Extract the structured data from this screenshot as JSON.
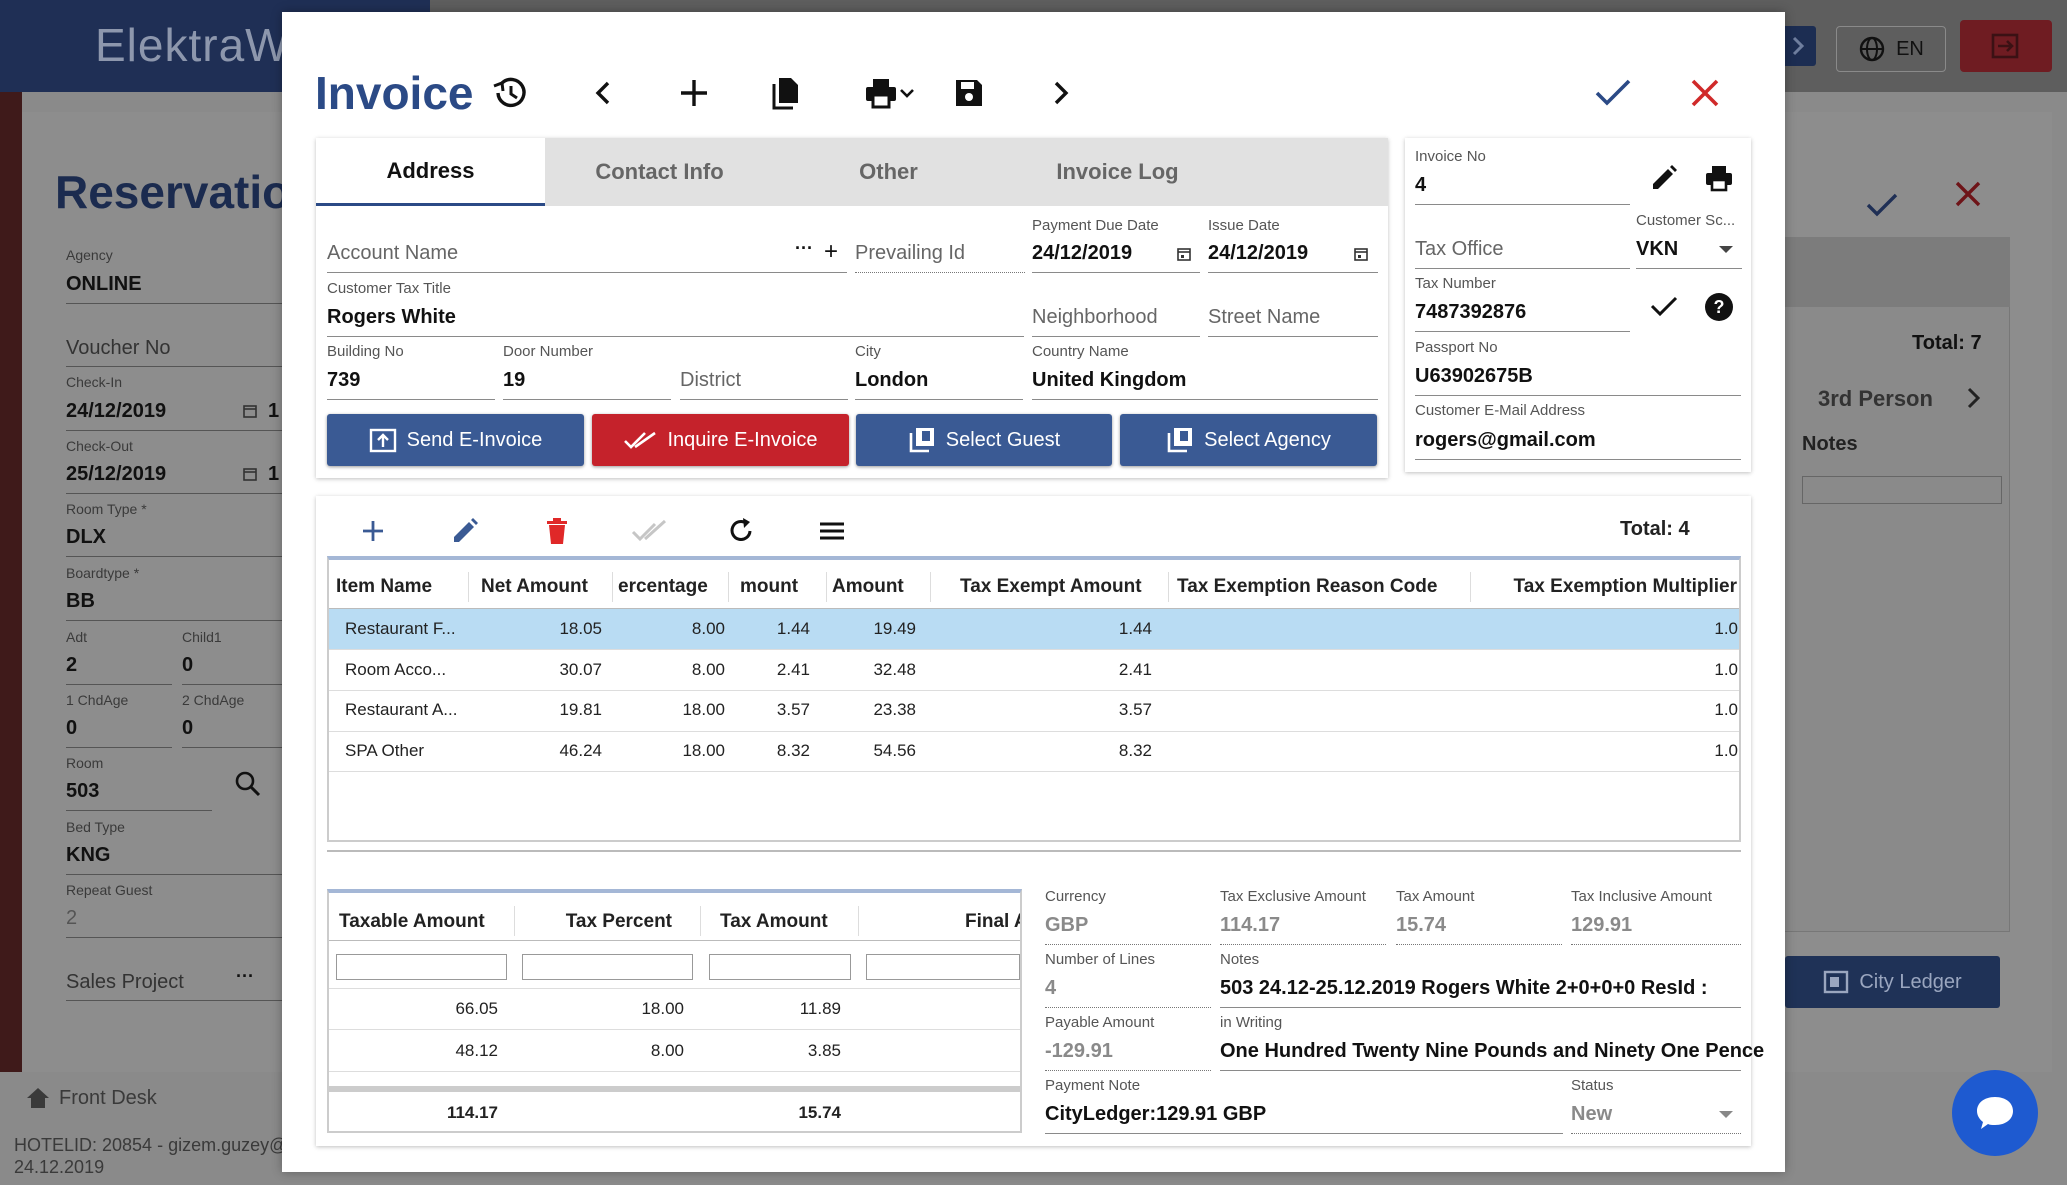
{
  "background": {
    "app_name": "ElektraW",
    "language": "EN",
    "reservation_title": "Reservation",
    "fields": {
      "agency": {
        "label": "Agency",
        "value": "ONLINE"
      },
      "voucher_no": {
        "placeholder": "Voucher No"
      },
      "check_in": {
        "label": "Check-In",
        "value": "24/12/2019",
        "extra": "1"
      },
      "check_out": {
        "label": "Check-Out",
        "value": "25/12/2019",
        "extra": "1"
      },
      "room_type": {
        "label": "Room Type *",
        "value": "DLX"
      },
      "boardtype": {
        "label": "Boardtype *",
        "value": "BB"
      },
      "adt": {
        "label": "Adt",
        "value": "2"
      },
      "child1": {
        "label": "Child1",
        "value": "0"
      },
      "chdage1": {
        "label": "1 ChdAge",
        "value": "0"
      },
      "chdage2": {
        "label": "2 ChdAge",
        "value": "0"
      },
      "room": {
        "label": "Room",
        "value": "503"
      },
      "bed_type": {
        "label": "Bed Type",
        "value": "KNG"
      },
      "repeat_guest": {
        "label": "Repeat Guest",
        "value": "2"
      },
      "sales_project": {
        "placeholder": "Sales Project"
      }
    },
    "right_panel": {
      "total": "Total: 7",
      "tab": "3rd Person",
      "notes": "Notes",
      "city_ledger": "City Ledger"
    },
    "front_desk": "Front Desk",
    "footer_line1": "HOTELID: 20854 - gizem.guzey@",
    "footer_line2": "24.12.2019"
  },
  "modal": {
    "title": "Invoice",
    "tabs": [
      "Address",
      "Contact Info",
      "Other",
      "Invoice Log"
    ],
    "active_tab": "Address",
    "address": {
      "account_name": {
        "placeholder": "Account Name"
      },
      "prevailing_id": {
        "placeholder": "Prevailing Id"
      },
      "payment_due_date": {
        "label": "Payment Due Date",
        "value": "24/12/2019"
      },
      "issue_date": {
        "label": "Issue Date",
        "value": "24/12/2019"
      },
      "customer_tax_title": {
        "label": "Customer Tax Title",
        "value": "Rogers White"
      },
      "neighborhood": {
        "placeholder": "Neighborhood"
      },
      "street_name": {
        "placeholder": "Street Name"
      },
      "building_no": {
        "label": "Building No",
        "value": "739"
      },
      "door_number": {
        "label": "Door Number",
        "value": "19"
      },
      "district": {
        "placeholder": "District"
      },
      "city": {
        "label": "City",
        "value": "London"
      },
      "country_name": {
        "label": "Country Name",
        "value": "United Kingdom"
      }
    },
    "buttons": {
      "send_einvoice": "Send E-Invoice",
      "inquire_einvoice": "Inquire E-Invoice",
      "select_guest": "Select Guest",
      "select_agency": "Select Agency"
    },
    "side": {
      "invoice_no": {
        "label": "Invoice No",
        "value": "4"
      },
      "tax_office": {
        "placeholder": "Tax Office"
      },
      "customer_scheme": {
        "label": "Customer Sc...",
        "value": "VKN"
      },
      "tax_number": {
        "label": "Tax Number",
        "value": "7487392876"
      },
      "passport_no": {
        "label": "Passport No",
        "value": "U63902675B"
      },
      "email": {
        "label": "Customer E-Mail Address",
        "value": "rogers@gmail.com"
      }
    },
    "items": {
      "total": "Total: 4",
      "columns": [
        "Item Name",
        "Net Amount",
        "ercentage",
        "mount",
        "Amount",
        "Tax Exempt Amount",
        "Tax Exemption Reason Code",
        "Tax Exemption Multiplier"
      ],
      "rows": [
        {
          "name": "Restaurant F...",
          "net": "18.05",
          "pct": "8.00",
          "tax": "1.44",
          "amount": "19.49",
          "exempt": "1.44",
          "reason": "",
          "mult": "1.0"
        },
        {
          "name": "Room Acco...",
          "net": "30.07",
          "pct": "8.00",
          "tax": "2.41",
          "amount": "32.48",
          "exempt": "2.41",
          "reason": "",
          "mult": "1.0"
        },
        {
          "name": "Restaurant A...",
          "net": "19.81",
          "pct": "18.00",
          "tax": "3.57",
          "amount": "23.38",
          "exempt": "3.57",
          "reason": "",
          "mult": "1.0"
        },
        {
          "name": "SPA Other",
          "net": "46.24",
          "pct": "18.00",
          "tax": "8.32",
          "amount": "54.56",
          "exempt": "8.32",
          "reason": "",
          "mult": "1.0"
        }
      ],
      "selected_row": 0
    },
    "tax_summary": {
      "columns": [
        "Taxable Amount",
        "Tax Percent",
        "Tax Amount",
        "Final A"
      ],
      "rows": [
        {
          "taxable": "66.05",
          "percent": "18.00",
          "tax": "11.89"
        },
        {
          "taxable": "48.12",
          "percent": "8.00",
          "tax": "3.85"
        }
      ],
      "totals": {
        "taxable": "114.17",
        "tax": "15.74"
      }
    },
    "summary": {
      "currency": {
        "label": "Currency",
        "value": "GBP"
      },
      "tax_exclusive": {
        "label": "Tax Exclusive Amount",
        "value": "114.17"
      },
      "tax_amount": {
        "label": "Tax Amount",
        "value": "15.74"
      },
      "tax_inclusive": {
        "label": "Tax Inclusive Amount",
        "value": "129.91"
      },
      "number_of_lines": {
        "label": "Number of Lines",
        "value": "4"
      },
      "notes": {
        "label": "Notes",
        "value": "503 24.12-25.12.2019 Rogers White 2+0+0+0 ResId :"
      },
      "payable_amount": {
        "label": "Payable Amount",
        "value": "-129.91"
      },
      "in_writing": {
        "label": "in Writing",
        "value": "One Hundred Twenty Nine Pounds and Ninety One Pence"
      },
      "payment_note": {
        "label": "Payment Note",
        "value": "CityLedger:129.91 GBP"
      },
      "status": {
        "label": "Status",
        "value": "New"
      }
    }
  },
  "colors": {
    "primary": "#3a5a94",
    "title": "#2b4a86",
    "danger": "#c5222b",
    "selected_row": "#b9dcf3"
  }
}
